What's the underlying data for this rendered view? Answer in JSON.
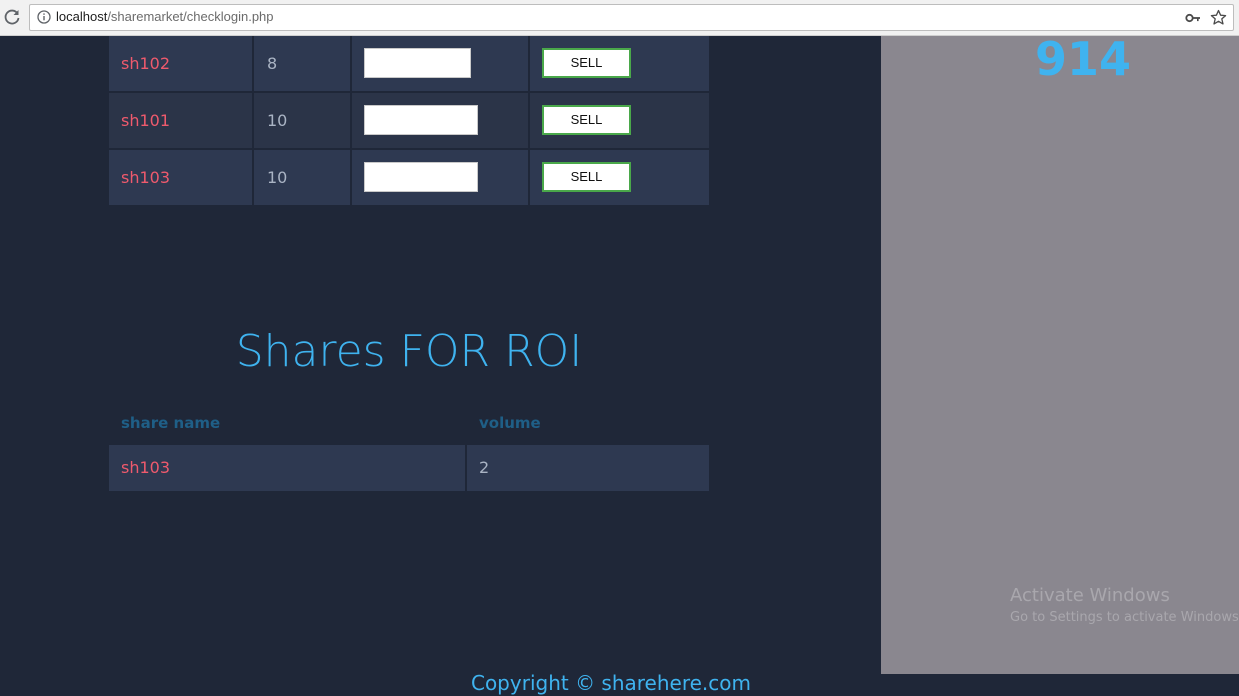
{
  "browser": {
    "url_host": "localhost",
    "url_path": "/sharemarket/checklogin.php"
  },
  "holdings": [
    {
      "share": "sh102",
      "volume": "8",
      "sell_label": "SELL"
    },
    {
      "share": "sh101",
      "volume": "10",
      "sell_label": "SELL"
    },
    {
      "share": "sh103",
      "volume": "10",
      "sell_label": "SELL"
    }
  ],
  "roi": {
    "heading": "Shares FOR ROI",
    "headers": {
      "share_name": "share name",
      "volume": "volume"
    },
    "rows": [
      {
        "share": "sh103",
        "volume": "2"
      }
    ]
  },
  "side_panel": {
    "number": "914"
  },
  "windows_notice": {
    "title": "Activate Windows",
    "subtitle": "Go to Settings to activate Windows."
  },
  "footer": {
    "copyright": "Copyright © sharehere.com"
  },
  "colors": {
    "background": "#1f2738",
    "cell": "#2e3951",
    "accent_blue": "#3fb3ef",
    "share_red": "#ef5a6d",
    "side_panel": "#8a878f",
    "button_border": "#4aa84a"
  },
  "icons": [
    "reload-icon",
    "info-icon",
    "key-icon",
    "star-icon"
  ]
}
